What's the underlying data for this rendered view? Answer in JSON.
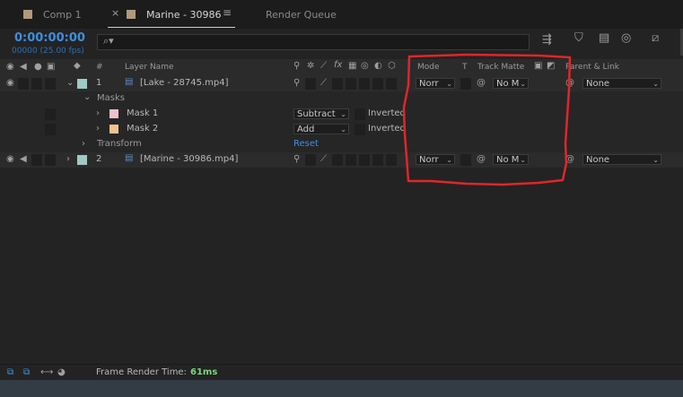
{
  "tabs": [
    {
      "label": "Comp 1"
    },
    {
      "label": "Marine - 30986"
    },
    {
      "label": "Render Queue"
    }
  ],
  "timeline": {
    "timecode": "0:00:00:00",
    "frame_fps": "00000 (25.00 fps)",
    "search_placeholder": "",
    "search_icon_glyph": "⌕▾"
  },
  "columns": {
    "number": "#",
    "layer_name": "Layer Name",
    "mode": "Mode",
    "t": "T",
    "track_matte": "Track Matte",
    "parent_link": "Parent & Link"
  },
  "layers": [
    {
      "number": "1",
      "name": "[Lake - 28745.mp4]",
      "label_color": "#9fc9c4",
      "mode": "Norr",
      "track_matte": "No M",
      "parent": "None"
    },
    {
      "number": "2",
      "name": "[Marine - 30986.mp4]",
      "label_color": "#9fc9c4",
      "mode": "Norr",
      "track_matte": "No M",
      "parent": "None"
    }
  ],
  "masks_group": {
    "label": "Masks"
  },
  "masks": [
    {
      "name": "Mask 1",
      "color": "#f0c0d0",
      "mode": "Subtract",
      "inverted": "Inverted"
    },
    {
      "name": "Mask 2",
      "color": "#f1c28e",
      "mode": "Add",
      "inverted": "Inverted"
    }
  ],
  "transform": {
    "label": "Transform",
    "reset": "Reset"
  },
  "footer": {
    "label": "Frame Render Time:",
    "value": "61ms"
  },
  "annotation_color": "#e0262a"
}
